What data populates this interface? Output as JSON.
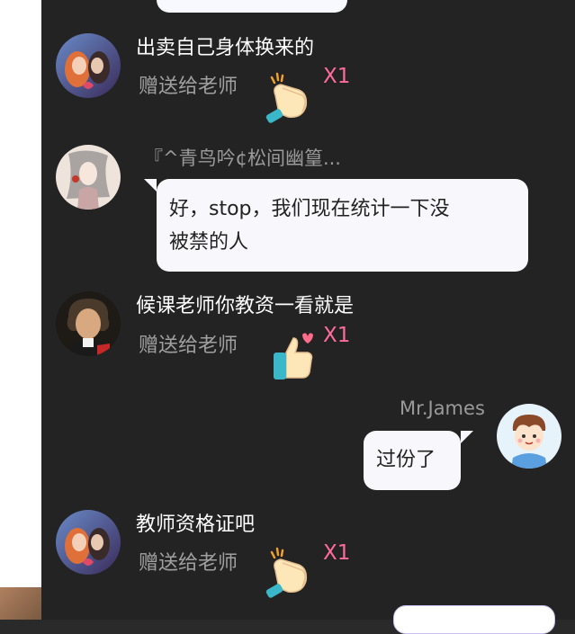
{
  "messages": [
    {
      "type": "gift",
      "user_avatar": "couple-avatar",
      "text": "出卖自己身体换来的",
      "gift_label": "赠送给老师",
      "count": "X1",
      "gift_icon": "clap-icon"
    },
    {
      "type": "chat-left",
      "user_avatar": "ink-painting-avatar",
      "name": "『^青鸟吟¢松间幽篁...",
      "line1": "好，stop，我们现在统计一下没",
      "line2": "被禁的人"
    },
    {
      "type": "gift",
      "user_avatar": "beethoven-avatar",
      "text": "候课老师你教资一看就是",
      "gift_label": "赠送给老师",
      "count": "X1",
      "gift_icon": "thumbs-up-icon"
    },
    {
      "type": "chat-right",
      "user_avatar": "cartoon-boy-avatar",
      "name": "Mr.James",
      "text": "过份了"
    },
    {
      "type": "gift",
      "user_avatar": "couple-avatar",
      "text": "教师资格证吧",
      "gift_label": "赠送给老师",
      "count": "X1",
      "gift_icon": "clap-icon"
    }
  ],
  "colors": {
    "background": "#232323",
    "bubble": "#f7f7fc",
    "count": "#ff6b9e",
    "gift_label": "#a0a0a0"
  }
}
